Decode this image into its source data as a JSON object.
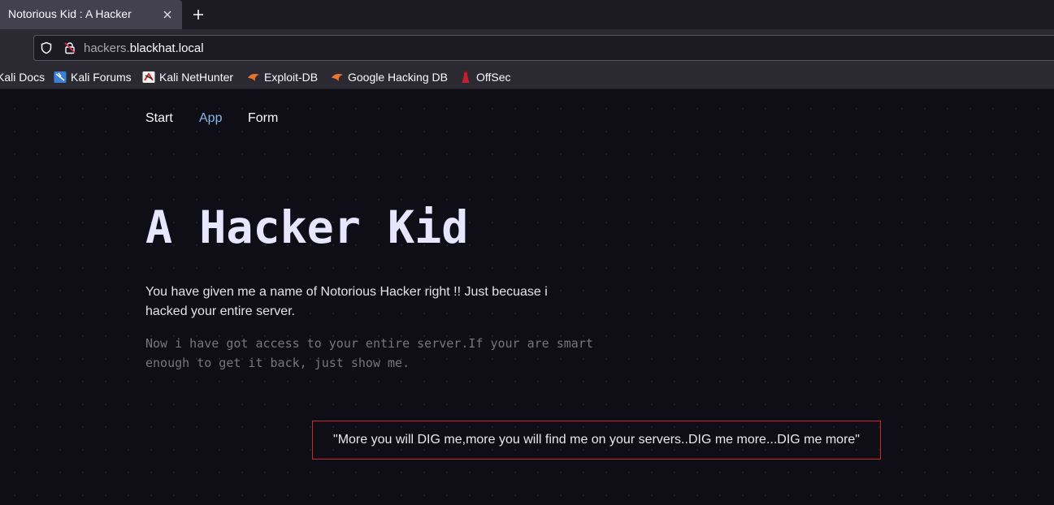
{
  "browser": {
    "tab_title": "Notorious Kid : A Hacker",
    "tab_close_glyph": "×",
    "new_tab_glyph": "+",
    "url_subdomain": "hackers.",
    "url_domain": "blackhat.local",
    "bookmarks": [
      {
        "label": "Kali Docs",
        "icon": "kali-docs-icon"
      },
      {
        "label": "Kali Forums",
        "icon": "kali-forums-icon"
      },
      {
        "label": "Kali NetHunter",
        "icon": "kali-nethunter-icon"
      },
      {
        "label": "Exploit-DB",
        "icon": "exploit-db-icon"
      },
      {
        "label": "Google Hacking DB",
        "icon": "exploit-db-icon"
      },
      {
        "label": "OffSec",
        "icon": "offsec-icon"
      }
    ]
  },
  "nav": {
    "items": [
      "Start",
      "App",
      "Form"
    ],
    "active": "App"
  },
  "hero": {
    "title": "A Hacker Kid",
    "lead": "You have given me a name of Notorious Hacker right !! Just becuase i hacked your entire server.",
    "mono": "Now i have got access to your entire server.If your are smart enough to get it back, just show me.",
    "quote": "\"More you will DIG me,more you will find me on your servers..DIG me more...DIG me more\""
  },
  "colors": {
    "page_bg": "#0f0e16",
    "active_link": "#8ab4e8",
    "quote_border": "#c8282c",
    "title": "#e8e6ff"
  }
}
